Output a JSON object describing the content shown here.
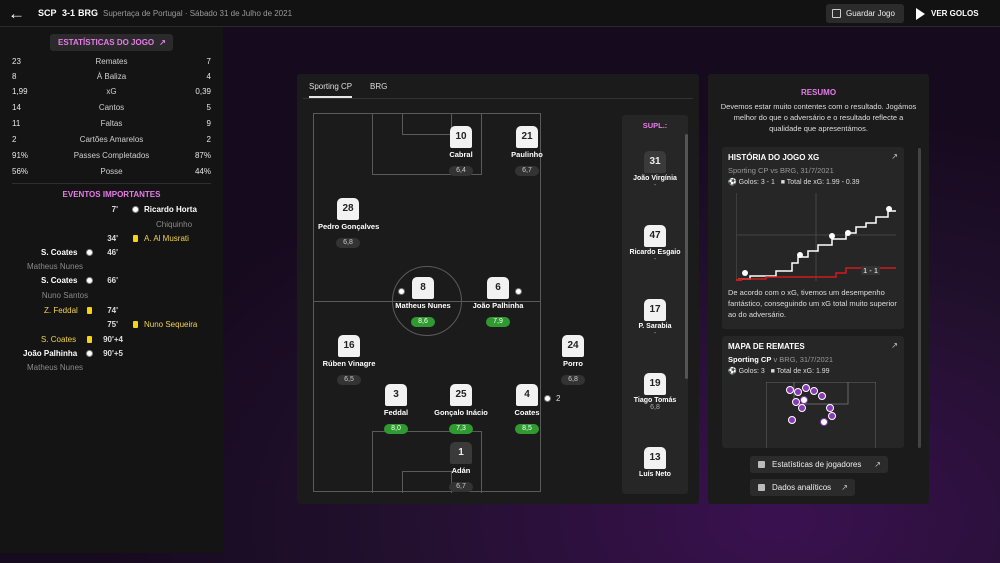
{
  "header": {
    "home_abbr": "SCP",
    "score": "3-1",
    "away_abbr": "BRG",
    "competition": "Supertaça de Portugal · Sábado 31 de Julho de 2021",
    "save_label": "Guardar Jogo",
    "watch_label": "VER GOLOS"
  },
  "stats": {
    "title": "ESTATÍSTICAS DO JOGO",
    "rows": [
      {
        "home": "23",
        "label": "Remates",
        "away": "7"
      },
      {
        "home": "8",
        "label": "À Baliza",
        "away": "4"
      },
      {
        "home": "1,99",
        "label": "xG",
        "away": "0,39"
      },
      {
        "home": "14",
        "label": "Cantos",
        "away": "5"
      },
      {
        "home": "11",
        "label": "Faltas",
        "away": "9"
      },
      {
        "home": "2",
        "label": "Cartões Amarelos",
        "away": "2"
      },
      {
        "home": "91%",
        "label": "Passes Completados",
        "away": "87%"
      },
      {
        "home": "56%",
        "label": "Posse",
        "away": "44%"
      }
    ]
  },
  "events": {
    "title": "EVENTOS IMPORTANTES",
    "items": [
      {
        "minute": "7'",
        "name": "Ricardo Horta",
        "sub": "Chiquinho"
      },
      {
        "minute": "34'",
        "name": "A. Al Musrati"
      },
      {
        "minute": "46'",
        "name": "S. Coates",
        "sub": "Matheus Nunes"
      },
      {
        "minute": "66'",
        "name": "S. Coates",
        "sub": "Nuno Santos"
      },
      {
        "minute": "74'",
        "name": "Z. Feddal"
      },
      {
        "minute": "75'",
        "name": "Nuno Sequeira"
      },
      {
        "minute": "90'+4",
        "name": "S. Coates"
      },
      {
        "minute": "90'+5",
        "name": "João Palhinha",
        "sub": "Matheus Nunes"
      }
    ]
  },
  "lineup": {
    "tabs": [
      "Sporting CP",
      "BRG"
    ],
    "players": [
      {
        "number": "10",
        "name": "Cabral",
        "rating": "6,4"
      },
      {
        "number": "21",
        "name": "Paulinho",
        "rating": "6,7"
      },
      {
        "number": "28",
        "name": "Pedro Gonçalves",
        "rating": "6,8"
      },
      {
        "number": "8",
        "name": "Matheus Nunes",
        "rating": "8,6"
      },
      {
        "number": "6",
        "name": "João Palhinha",
        "rating": "7,9"
      },
      {
        "number": "16",
        "name": "Rúben Vinagre",
        "rating": "6,5"
      },
      {
        "number": "24",
        "name": "Porro",
        "rating": "6,8"
      },
      {
        "number": "3",
        "name": "Feddal",
        "rating": "8,0"
      },
      {
        "number": "25",
        "name": "Gonçalo Inácio",
        "rating": "7,3"
      },
      {
        "number": "4",
        "name": "Coates",
        "rating": "8,5",
        "goals": "2"
      },
      {
        "number": "1",
        "name": "Adán",
        "rating": "6,7"
      }
    ],
    "subs_title": "SUPL.:",
    "subs": [
      {
        "number": "31",
        "name": "João Virgínia",
        "rating": "-"
      },
      {
        "number": "47",
        "name": "Ricardo Esgaio",
        "rating": "-"
      },
      {
        "number": "17",
        "name": "P. Sarabia",
        "rating": "-"
      },
      {
        "number": "19",
        "name": "Tiago Tomás",
        "rating": "6,8"
      },
      {
        "number": "13",
        "name": "Luís Neto",
        "rating": ""
      }
    ]
  },
  "summary": {
    "title": "RESUMO",
    "text": "Devemos estar muito contentes com o resultado. Jogámos melhor do que o adversário e o resultado reflecte a qualidade que apresentámos.",
    "xg_card": {
      "title": "HISTÓRIA DO JOGO XG",
      "subtitle": "Sporting CP vs BRG, 31/7/2021",
      "goals": "Golos: 3 - 1",
      "xg_total": "Total de xG: 1.99 - 0.39",
      "score_marker": "1 - 1",
      "note": "De acordo com o xG, tivemos um desempenho fantástico, conseguindo um xG total muito superior ao do adversário."
    },
    "shots_card": {
      "title": "MAPA DE REMATES",
      "team": "Sporting CP",
      "subtitle_rest": "v BRG, 31/7/2021",
      "goals": "Golos: 3",
      "xg_total": "Total de xG: 1.99"
    },
    "buttons": {
      "player_stats": "Estatísticas de jogadores",
      "analytics": "Dados analíticos"
    }
  },
  "colors": {
    "accent": "#e87be8",
    "good_rating": "#2f9a2f",
    "xg_home": "#ffffff",
    "xg_away": "#d11a1a",
    "yellow_card": "#f5d319"
  }
}
